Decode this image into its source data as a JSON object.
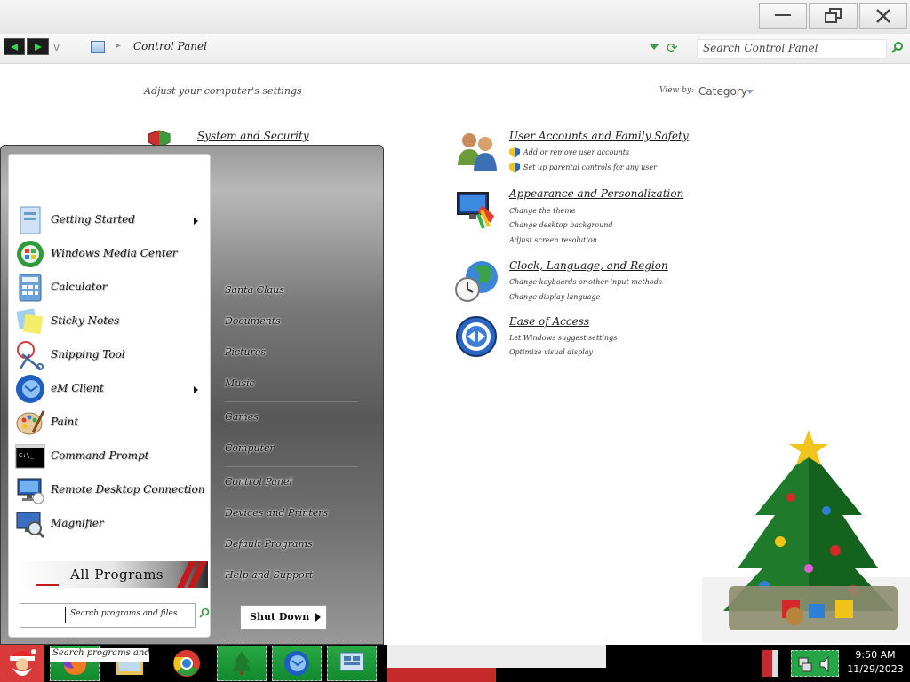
{
  "window": {
    "breadcrumb": "Control Panel",
    "search_placeholder": "Search Control Panel",
    "nav_history": "v"
  },
  "header": {
    "adjust_text": "Adjust your computer's settings",
    "view_by_label": "View by:",
    "view_by_value": "Category"
  },
  "categories": {
    "system_security": {
      "title": "System and Security"
    },
    "user_accounts": {
      "title": "User Accounts and Family Safety",
      "links": [
        "Add or remove user accounts",
        "Set up parental controls for any user"
      ]
    },
    "appearance": {
      "title": "Appearance and Personalization",
      "links": [
        "Change the theme",
        "Change desktop background",
        "Adjust screen resolution"
      ]
    },
    "clock": {
      "title": "Clock, Language, and Region",
      "links": [
        "Change keyboards or other input methods",
        "Change display language"
      ]
    },
    "ease": {
      "title": "Ease of Access",
      "links": [
        "Let Windows suggest settings",
        "Optimize visual display"
      ]
    }
  },
  "start_menu": {
    "programs": [
      {
        "label": "Getting Started",
        "has_submenu": true,
        "icon": "getting-started-icon"
      },
      {
        "label": "Windows Media Center",
        "has_submenu": false,
        "icon": "windows-media-center-icon"
      },
      {
        "label": "Calculator",
        "has_submenu": false,
        "icon": "calculator-icon"
      },
      {
        "label": "Sticky Notes",
        "has_submenu": false,
        "icon": "sticky-notes-icon"
      },
      {
        "label": "Snipping Tool",
        "has_submenu": false,
        "icon": "scissors-icon"
      },
      {
        "label": "eM Client",
        "has_submenu": true,
        "icon": "email-client-icon"
      },
      {
        "label": "Paint",
        "has_submenu": false,
        "icon": "paint-palette-icon"
      },
      {
        "label": "Command Prompt",
        "has_submenu": false,
        "icon": "command-prompt-icon"
      },
      {
        "label": "Remote Desktop Connection",
        "has_submenu": false,
        "icon": "remote-desktop-icon"
      },
      {
        "label": "Magnifier",
        "has_submenu": false,
        "icon": "magnifier-icon"
      }
    ],
    "all_programs": "All Programs",
    "search_placeholder": "Search programs and files",
    "right_items": [
      "Santa Claus",
      "Documents",
      "Pictures",
      "Music",
      "Games",
      "Computer",
      "Control Panel",
      "Devices and Printers",
      "Default Programs",
      "Help and Support"
    ],
    "shutdown_label": "Shut Down"
  },
  "taskbar": {
    "search_overlay": "Search programs and files",
    "time": "9:50 AM",
    "date": "11/29/2023",
    "buttons": [
      "santa-start",
      "firefox",
      "file-explorer",
      "chrome",
      "christmas-tree-gadget",
      "thunderbird",
      "control-panel"
    ]
  },
  "colors": {
    "taskbar_green": "#25a646",
    "accent_red": "#c42a2a",
    "start_bg_top": "#b8b8b8",
    "start_bg_mid": "#585858"
  }
}
